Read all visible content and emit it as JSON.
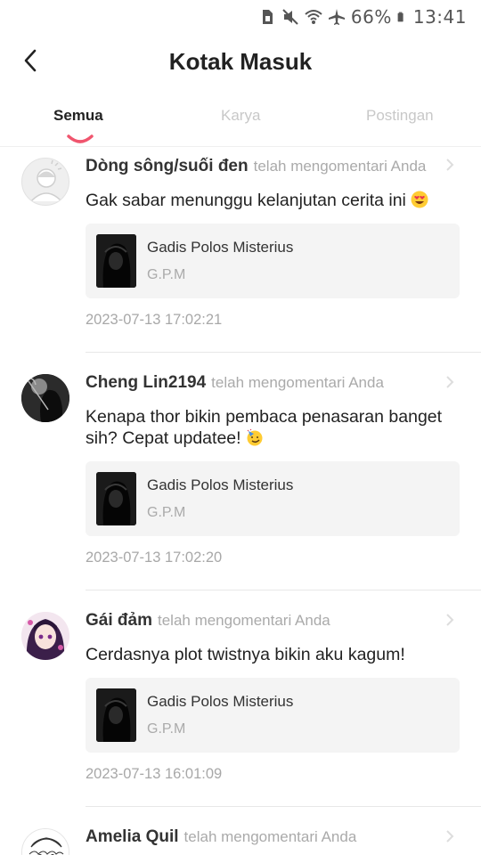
{
  "status_bar": {
    "battery_percent": "66%",
    "time": "13:41",
    "icons": [
      "sim-icon",
      "mute-icon",
      "wifi-icon",
      "airplane-icon",
      "battery-icon"
    ]
  },
  "header": {
    "back_icon": "chevron-left-icon",
    "title": "Kotak Masuk"
  },
  "tabs": [
    {
      "label": "Semua",
      "active": true
    },
    {
      "label": "Karya",
      "active": false
    },
    {
      "label": "Postingan",
      "active": false
    }
  ],
  "colors": {
    "accent": "#f0556e",
    "inactive_tab": "#c8c8c8",
    "secondary_text": "#aaaaaa",
    "card_bg": "#f4f4f4"
  },
  "notifications": [
    {
      "user": "Dòng sông/suối đen",
      "action": "telah mengomentari Anda",
      "comment": "Gak sabar menunggu kelanjutan cerita ini",
      "emoji": "heart-eyes-emoji",
      "work_title": "Gadis Polos Misterius",
      "work_author": "G.P.M",
      "timestamp": "2023-07-13 17:02:21",
      "avatar": "default-avatar"
    },
    {
      "user": "Cheng Lin2194",
      "action": "telah mengomentari Anda",
      "comment": "Kenapa thor bikin pembaca penasaran banget sih? Cepat updatee!",
      "emoji": "party-face-emoji",
      "work_title": "Gadis Polos Misterius",
      "work_author": "G.P.M",
      "timestamp": "2023-07-13 17:02:20",
      "avatar": "dark-figure-avatar"
    },
    {
      "user": "Gái đảm",
      "action": "telah mengomentari Anda",
      "comment": "Cerdasnya plot twistnya bikin aku kagum!",
      "emoji": "",
      "work_title": "Gadis Polos Misterius",
      "work_author": "G.P.M",
      "timestamp": "2023-07-13 16:01:09",
      "avatar": "anime-girl-avatar"
    },
    {
      "user": "Amelia Quil",
      "action": "telah mengomentari Anda",
      "avatar": "sketch-avatar"
    }
  ]
}
